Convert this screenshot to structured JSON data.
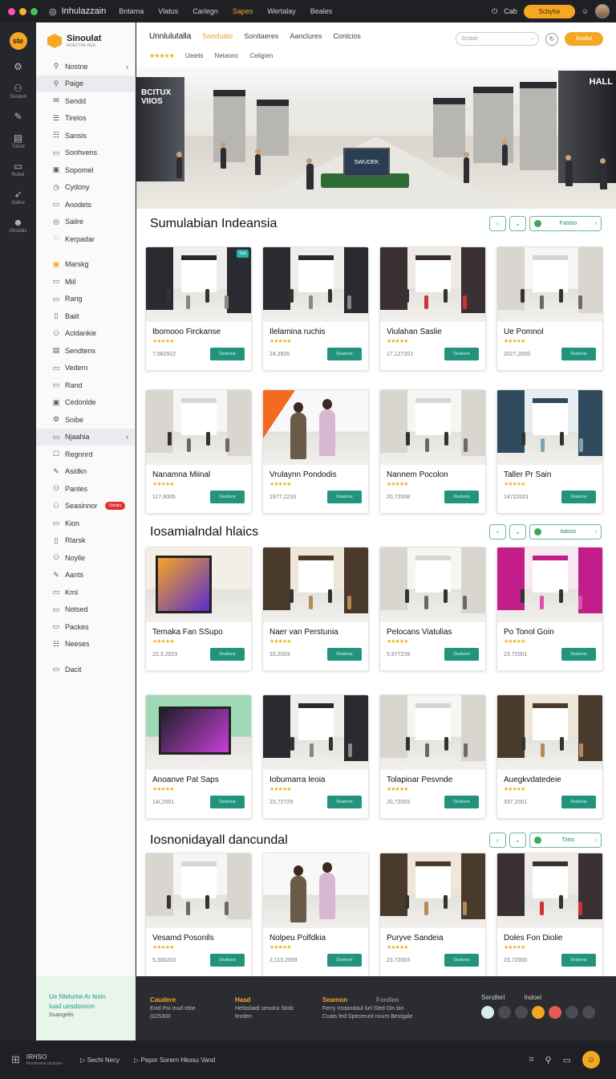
{
  "topbar": {
    "app_name": "Inhulazzain",
    "menu": [
      "Bntama",
      "Vlatus",
      "Carlegn",
      "Sapes",
      "Wertalay",
      "Beales"
    ],
    "highlight_index": 3,
    "user_label": "Cab",
    "search_label": "Scbyhe"
  },
  "rail": {
    "logo": "ste",
    "items": [
      {
        "icon": "gear-icon",
        "glyph": "⚙",
        "label": ""
      },
      {
        "icon": "user-icon",
        "glyph": "⚇",
        "label": "Serahdl"
      },
      {
        "icon": "pen-icon",
        "glyph": "✎",
        "label": ""
      },
      {
        "icon": "book-icon",
        "glyph": "▤",
        "label": "Tutusl"
      },
      {
        "icon": "folder-icon",
        "glyph": "▭",
        "label": "Ruled"
      },
      {
        "icon": "send-icon",
        "glyph": "➶",
        "label": "Sollne"
      },
      {
        "icon": "mascot-icon",
        "glyph": "☻",
        "label": "Obsdals"
      }
    ]
  },
  "sidebar": {
    "brand_title": "Sinoulat",
    "brand_sub": "ROEUTRK REA",
    "items": [
      {
        "label": "Nostne",
        "glyph": "⚲",
        "chevron": true
      },
      {
        "label": "Paige",
        "glyph": "⚲",
        "active": true
      },
      {
        "label": "Sendd",
        "glyph": "✉"
      },
      {
        "label": "Tirelos",
        "glyph": "☰"
      },
      {
        "label": "Sansis",
        "glyph": "☷"
      },
      {
        "label": "Sonhvens",
        "glyph": "▭"
      },
      {
        "label": "Sopomel",
        "glyph": "▣"
      },
      {
        "label": "Cydony",
        "glyph": "◷"
      },
      {
        "label": "Anodets",
        "glyph": "▭"
      },
      {
        "label": "Sailre",
        "glyph": "◎"
      },
      {
        "label": "Kerpadar",
        "glyph": "♡"
      },
      {
        "gap": true
      },
      {
        "label": "Marskg",
        "glyph": "▣",
        "accent": true
      },
      {
        "label": "Miil",
        "glyph": "▭"
      },
      {
        "label": "Rarig",
        "glyph": "▭"
      },
      {
        "label": "Baiit",
        "glyph": "▯"
      },
      {
        "label": "Acldankie",
        "glyph": "⚇"
      },
      {
        "label": "Sendtens",
        "glyph": "▤"
      },
      {
        "label": "Vedern",
        "glyph": "▭"
      },
      {
        "label": "Rand",
        "glyph": "▭"
      },
      {
        "label": "Cedonlde",
        "glyph": "▣"
      },
      {
        "label": "Snibe",
        "glyph": "⚙"
      },
      {
        "label": "Njaahia",
        "glyph": "▭",
        "active": true,
        "chevron": true
      },
      {
        "label": "Regnnrd",
        "glyph": "☐"
      },
      {
        "label": "Asidkn",
        "glyph": "✎"
      },
      {
        "label": "Pantes",
        "glyph": "⚇"
      },
      {
        "label": "Seasinnor",
        "glyph": "⚇",
        "badge": "Sioidiu",
        "green": true
      },
      {
        "label": "Kion",
        "glyph": "▭"
      },
      {
        "label": "Rlarsk",
        "glyph": "▯"
      },
      {
        "label": "Noylle",
        "glyph": "⚇"
      },
      {
        "label": "Aants",
        "glyph": "✎"
      },
      {
        "label": "Krnl",
        "glyph": "▭"
      },
      {
        "label": "Notsed",
        "glyph": "▭"
      },
      {
        "label": "Packes",
        "glyph": "▭"
      },
      {
        "label": "Neeses",
        "glyph": "☷"
      },
      {
        "gap": true
      },
      {
        "label": "Dacit",
        "glyph": "▭"
      }
    ]
  },
  "main": {
    "nav": [
      "Unnlulutalla",
      "Snnduats",
      "Sonitaeres",
      "Aanclures",
      "Conlcios"
    ],
    "sub_nav": [
      "★★★★★",
      "Ueiets",
      "Netaonc",
      "Celigien"
    ],
    "search_placeholder": "Scstsh",
    "cta_label": "Scalke",
    "hero": {
      "sign_left": "BCITUX VIIOS",
      "sign_right": "HALL",
      "kiosk": "SWUDEK"
    }
  },
  "sections": [
    {
      "title": "Sumulabian Indeansia",
      "wide_label": "Fatnbo",
      "cards": [
        {
          "title": "Ibomooo Firckanse",
          "price": "7,582922",
          "tag": "Sab",
          "theme": "dark"
        },
        {
          "title": "Ilelamina ruchis",
          "price": "24,3920",
          "theme": "dark"
        },
        {
          "title": "Viulahan Saslie",
          "price": "17,127201",
          "theme": "red"
        },
        {
          "title": "Ue Pomnol",
          "price": "2027,2000",
          "theme": "light"
        },
        {
          "title": "Nanamna Miinal",
          "price": "117,6005",
          "theme": "light"
        },
        {
          "title": "Vrulaynn Pondodis",
          "price": "1977,2216",
          "theme": "people"
        },
        {
          "title": "Nannem Pocolon",
          "price": "20,72008",
          "theme": "light"
        },
        {
          "title": "Taller Pr Sain",
          "price": "14722001",
          "theme": "blue"
        }
      ]
    },
    {
      "title": "Iosamialndal hlaics",
      "wide_label": "Itabsis",
      "cards": [
        {
          "title": "Temaka Fan SSupo",
          "price": "22,3,2023",
          "theme": "screen"
        },
        {
          "title": "Naer van Perstunia",
          "price": "33,2003",
          "theme": "warm"
        },
        {
          "title": "Pelocans Viatulias",
          "price": "5,977228",
          "theme": "light"
        },
        {
          "title": "Po Tonol Goin",
          "price": "23,72001",
          "theme": "pink"
        },
        {
          "title": "Anoanve Pat Saps",
          "price": "14/,2001",
          "theme": "tv"
        },
        {
          "title": "Iobumarra leoia",
          "price": "23,72729",
          "theme": "dark"
        },
        {
          "title": "Tolapioar Pesvnde",
          "price": "20,72003",
          "theme": "light"
        },
        {
          "title": "Auegkvdatedeie",
          "price": "337,2001",
          "theme": "warm"
        }
      ]
    },
    {
      "title": "Iosnonidayall dancundal",
      "wide_label": "Tiittis",
      "cards": [
        {
          "title": "Vesamd Posonils",
          "price": "5,300203",
          "theme": "light"
        },
        {
          "title": "Nolpeu Polfdkia",
          "price": "2,113,2009",
          "theme": "people"
        },
        {
          "title": "Puryve Sandeia",
          "price": "23,72003",
          "theme": "warm"
        },
        {
          "title": "Doles Fon Diolie",
          "price": "23,72000",
          "theme": "red"
        }
      ]
    }
  ],
  "card_button": "Deuhone",
  "footer": {
    "promo": [
      "Ue Ntelume Ar lesin",
      "Iuad uesdooxon",
      "Suangelis"
    ],
    "cols": [
      {
        "head": "Caudere",
        "lines": [
          "Exid Poi mud tebe",
          "(025300"
        ]
      },
      {
        "head": "Haad",
        "lines": [
          "Hefaslaidi sesolra Stisb",
          "lenden"
        ]
      },
      {
        "head": "Seamon",
        "lines": [
          "Ferry Instandaul lurl Sled Din bin",
          "Coats fed Specerunt nours Bestgale"
        ]
      },
      {
        "head": "Fonllen",
        "lines": []
      }
    ],
    "social_labels": [
      "Sendlerl",
      "Indoel"
    ]
  },
  "statusbar": {
    "left_title": "IRHSO",
    "left_sub": "Mentersiue dashane",
    "items": [
      "Sechi Necy",
      "Pepor Sorern Hkosu Vand"
    ]
  },
  "colors": {
    "accent": "#f5a623",
    "teal": "#22947e",
    "badge": "#e03030"
  }
}
